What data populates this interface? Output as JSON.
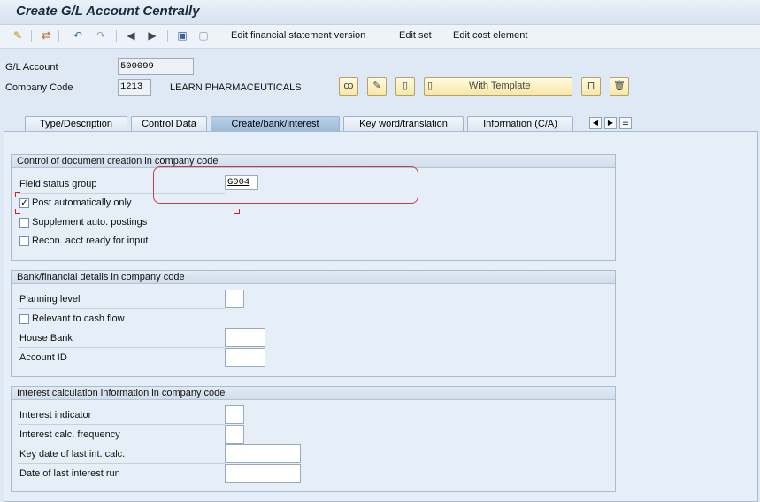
{
  "window": {
    "title": "Create G/L Account Centrally"
  },
  "toolbar": {
    "edit_fs_version": "Edit financial statement version",
    "edit_set": "Edit set",
    "edit_cost_element": "Edit cost element",
    "icons": [
      "display-change-icon",
      "other-icon",
      "undo-icon",
      "redo-icon",
      "prev-icon",
      "next-icon",
      "save-icon",
      "print-icon"
    ]
  },
  "header": {
    "gl_account_label": "G/L Account",
    "gl_account_value": "500099",
    "company_code_label": "Company Code",
    "company_code_value": "1213",
    "company_name": "LEARN PHARMACEUTICALS",
    "with_template": "With Template"
  },
  "tabs": [
    "Type/Description",
    "Control Data",
    "Create/bank/interest",
    "Key word/translation",
    "Information (C/A)"
  ],
  "active_tab": "Create/bank/interest",
  "group1": {
    "title": "Control of document creation in company code",
    "field_status_group_label": "Field status group",
    "field_status_group_value": "G004",
    "post_auto_label": "Post automatically only",
    "post_auto_checked": true,
    "supplement_label": "Supplement auto. postings",
    "recon_label": "Recon. acct ready for input"
  },
  "group2": {
    "title": "Bank/financial details in company code",
    "planning_level_label": "Planning level",
    "relevant_cash_label": "Relevant to cash flow",
    "house_bank_label": "House Bank",
    "account_id_label": "Account ID"
  },
  "group3": {
    "title": "Interest calculation information in company code",
    "interest_indicator_label": "Interest indicator",
    "interest_freq_label": "Interest calc. frequency",
    "key_date_label": "Key date of last int. calc.",
    "date_last_run_label": "Date of last interest run"
  },
  "colors": {
    "highlight": "#c0404a",
    "active_tab": "#9dbbda"
  }
}
